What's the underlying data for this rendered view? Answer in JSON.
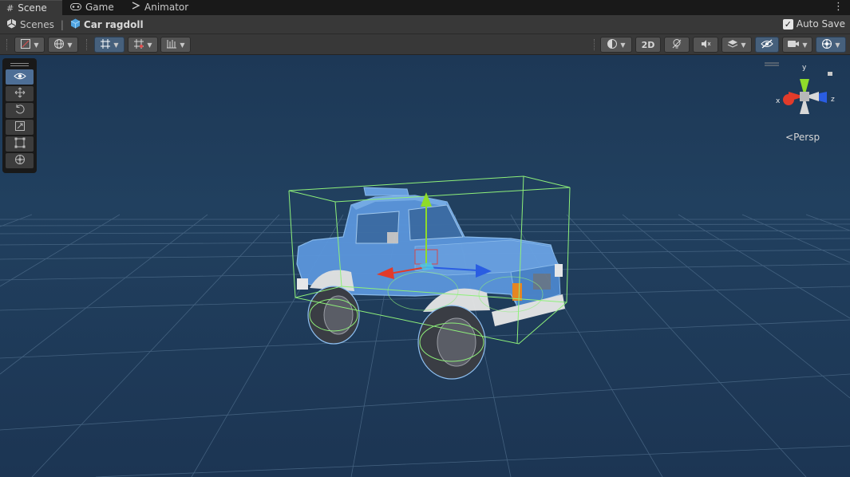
{
  "tabs": [
    {
      "label": "Scene",
      "icon": "grid-icon",
      "active": true
    },
    {
      "label": "Game",
      "icon": "gamepad-icon",
      "active": false
    },
    {
      "label": "Animator",
      "icon": "animator-icon",
      "active": false
    }
  ],
  "breadcrumb": {
    "root": "Scenes",
    "current": "Car ragdoll"
  },
  "auto_save": {
    "label": "Auto Save",
    "checked": true
  },
  "toolbar": {
    "button_2d": "2D"
  },
  "tools": [
    "view-tool-icon",
    "move-tool-icon",
    "rotate-tool-icon",
    "scale-tool-icon",
    "rect-tool-icon",
    "transform-tool-icon"
  ],
  "orientation_gizmo": {
    "x_label": "x",
    "y_label": "y",
    "z_label": "z",
    "projection_label": "Persp"
  },
  "colors": {
    "viewport_bg": "#1d3856",
    "selection_outline": "#8ef07a",
    "car_body": "#5b96dc",
    "axis_x": "#e23b2a",
    "axis_y": "#8fdc2a",
    "axis_z": "#2a5de2"
  }
}
